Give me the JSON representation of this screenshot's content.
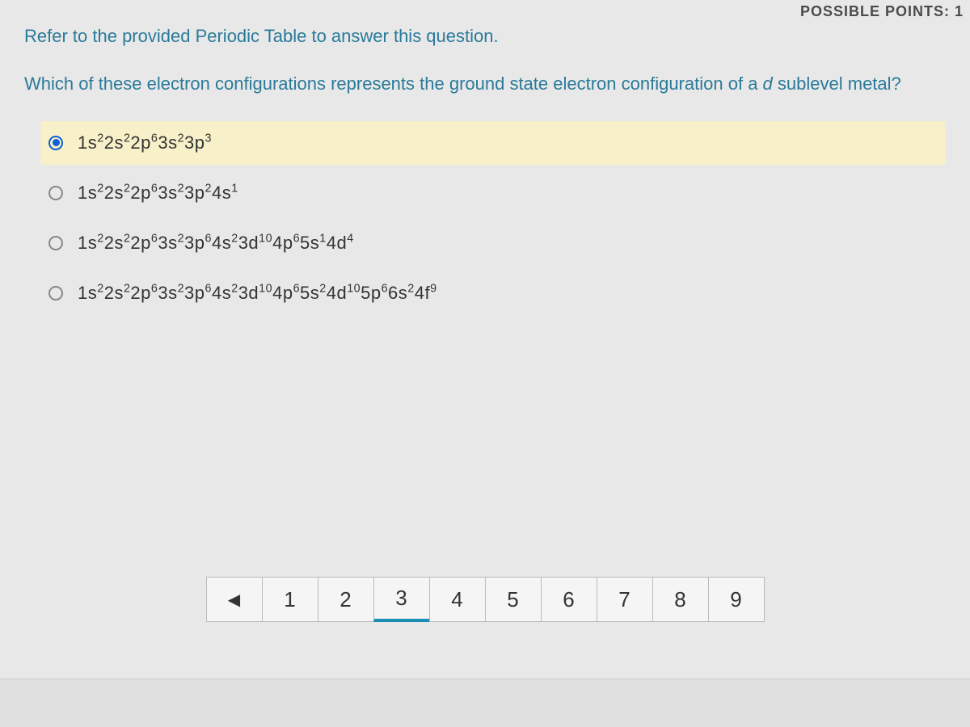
{
  "header": {
    "pointsLabel": "POSSIBLE POINTS: 1"
  },
  "question": {
    "instruction": "Refer to the provided Periodic Table to answer this question.",
    "prompt_pre": "Which of these electron configurations represents the ground state electron configuration of a ",
    "prompt_italic": "d",
    "prompt_post": " sublevel metal?"
  },
  "options": [
    {
      "segments": [
        {
          "b": "1s",
          "s": "2"
        },
        {
          "b": "2s",
          "s": "2"
        },
        {
          "b": "2p",
          "s": "6"
        },
        {
          "b": "3s",
          "s": "2"
        },
        {
          "b": "3p",
          "s": "3"
        }
      ],
      "selected": true
    },
    {
      "segments": [
        {
          "b": "1s",
          "s": "2"
        },
        {
          "b": "2s",
          "s": "2"
        },
        {
          "b": "2p",
          "s": "6"
        },
        {
          "b": "3s",
          "s": "2"
        },
        {
          "b": "3p",
          "s": "2"
        },
        {
          "b": "4s",
          "s": "1"
        }
      ],
      "selected": false
    },
    {
      "segments": [
        {
          "b": "1s",
          "s": "2"
        },
        {
          "b": "2s",
          "s": "2"
        },
        {
          "b": "2p",
          "s": "6"
        },
        {
          "b": "3s",
          "s": "2"
        },
        {
          "b": "3p",
          "s": "6"
        },
        {
          "b": "4s",
          "s": "2"
        },
        {
          "b": "3d",
          "s": "10"
        },
        {
          "b": "4p",
          "s": "6"
        },
        {
          "b": "5s",
          "s": "1"
        },
        {
          "b": "4d",
          "s": "4"
        }
      ],
      "selected": false
    },
    {
      "segments": [
        {
          "b": "1s",
          "s": "2"
        },
        {
          "b": "2s",
          "s": "2"
        },
        {
          "b": "2p",
          "s": "6"
        },
        {
          "b": "3s",
          "s": "2"
        },
        {
          "b": "3p",
          "s": "6"
        },
        {
          "b": "4s",
          "s": "2"
        },
        {
          "b": "3d",
          "s": "10"
        },
        {
          "b": "4p",
          "s": "6"
        },
        {
          "b": "5s",
          "s": "2"
        },
        {
          "b": "4d",
          "s": "10"
        },
        {
          "b": "5p",
          "s": "6"
        },
        {
          "b": "6s",
          "s": "2"
        },
        {
          "b": "4f",
          "s": "9"
        }
      ],
      "selected": false
    }
  ],
  "pagination": {
    "prevGlyph": "◀",
    "pages": [
      "1",
      "2",
      "3",
      "4",
      "5",
      "6",
      "7",
      "8",
      "9"
    ],
    "current": 3
  }
}
